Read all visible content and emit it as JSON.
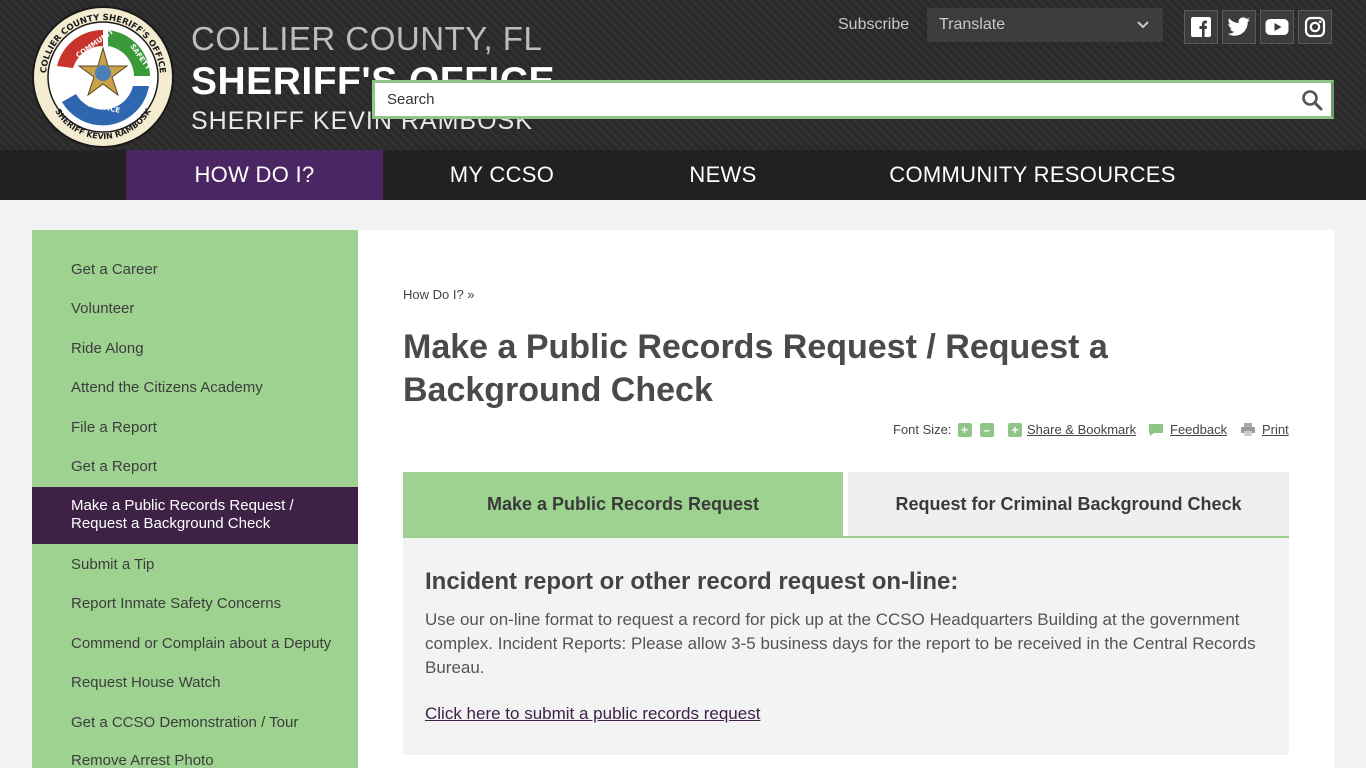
{
  "header": {
    "brand_line1": "COLLIER COUNTY, FL",
    "brand_line2": "SHERIFF'S OFFICE",
    "brand_line3": "SHERIFF KEVIN RAMBOSK",
    "seal_text_top": "COLLIER COUNTY SHERIFF'S OFFICE",
    "seal_text_bottom": "SHERIFF KEVIN RAMBOSK",
    "seal_words": [
      "COMMUNITY",
      "SAFETY",
      "SERVICE"
    ],
    "subscribe_label": "Subscribe",
    "translate_label": "Translate",
    "search_placeholder": "Search",
    "social_icons": [
      "facebook-icon",
      "twitter-icon",
      "youtube-icon",
      "instagram-icon"
    ]
  },
  "nav": {
    "items": [
      {
        "label": "HOW DO I?"
      },
      {
        "label": "MY CCSO"
      },
      {
        "label": "NEWS"
      },
      {
        "label": "COMMUNITY RESOURCES"
      }
    ],
    "active_index": 0
  },
  "sidebar": {
    "items": [
      {
        "label": "Get a Career"
      },
      {
        "label": "Volunteer"
      },
      {
        "label": "Ride Along"
      },
      {
        "label": "Attend the Citizens Academy"
      },
      {
        "label": "File a Report"
      },
      {
        "label": "Get a Report"
      },
      {
        "label": "Make a Public Records Request / Request a Background Check"
      },
      {
        "label": "Submit a Tip"
      },
      {
        "label": "Report Inmate Safety Concerns"
      },
      {
        "label": "Commend or Complain about a Deputy"
      },
      {
        "label": "Request House Watch"
      },
      {
        "label": "Get a CCSO Demonstration / Tour"
      },
      {
        "label": "Remove Arrest Photo"
      }
    ],
    "active_index": 6
  },
  "main": {
    "breadcrumb": "How Do I? »",
    "title": "Make a Public Records Request / Request a Background Check",
    "tools": {
      "font_size_label": "Font Size:",
      "plus_glyph": "+",
      "minus_glyph": "–",
      "share_label": "Share & Bookmark",
      "feedback_label": "Feedback",
      "print_label": "Print"
    },
    "tabs": [
      {
        "label": "Make a Public Records Request"
      },
      {
        "label": "Request for Criminal Background Check"
      }
    ],
    "active_tab": 0,
    "panel": {
      "heading": "Incident report or other record request on-line:",
      "body": "Use our on-line format to request a record for pick up at the CCSO Headquarters Building at the government complex. Incident Reports: Please allow 3-5 business days for the report to be received in the Central Records Bureau.",
      "link": "Click here to submit a public records request"
    }
  },
  "colors": {
    "accent_green": "#9ed290",
    "accent_purple": "#4a2763",
    "active_purple": "#3e2246",
    "header_bg": "#2a2a2a",
    "nav_bg": "#222121"
  }
}
